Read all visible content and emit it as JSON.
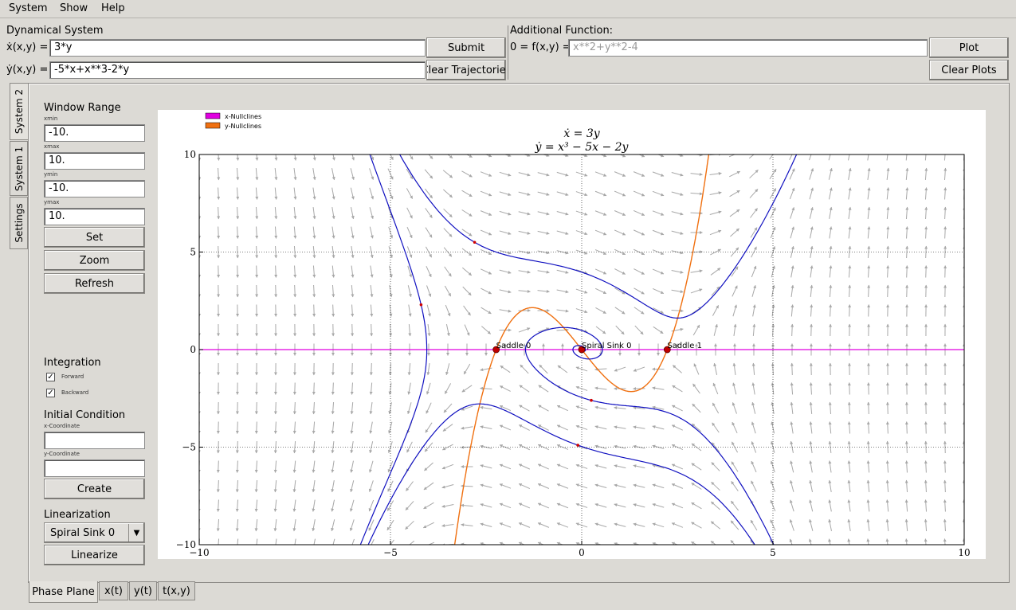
{
  "menu": {
    "items": [
      {
        "label": "System"
      },
      {
        "label": "Show"
      },
      {
        "label": "Help"
      }
    ]
  },
  "system": {
    "title": "Dynamical System",
    "xdot_label": "ẋ(x,y) =",
    "xdot_value": "3*y",
    "ydot_label": "ẏ(x,y) =",
    "ydot_value": "-5*x+x**3-2*y",
    "submit_label": "Submit",
    "clear_label": "Clear Trajectories"
  },
  "additional": {
    "title": "Additional Function:",
    "f_label": "0 = f(x,y) =",
    "f_placeholder": "x**2+y**2-4",
    "plot_label": "Plot",
    "clear_plots_label": "Clear Plots"
  },
  "side_tabs": [
    "System 2",
    "System 1",
    "Settings"
  ],
  "window_range": {
    "title": "Window Range",
    "xmin_label": "xmin",
    "xmin": "-10.",
    "xmax_label": "xmax",
    "xmax": "10.",
    "ymin_label": "ymin",
    "ymin": "-10.",
    "ymax_label": "ymax",
    "ymax": "10.",
    "set_label": "Set",
    "zoom_label": "Zoom",
    "refresh_label": "Refresh"
  },
  "integration": {
    "title": "Integration",
    "forward_label": "Forward",
    "forward_checked": true,
    "backward_label": "Backward",
    "backward_checked": true
  },
  "initial_condition": {
    "title": "Initial Condition",
    "x_label": "x-Coordinate",
    "x_value": "",
    "y_label": "y-Coordinate",
    "y_value": "",
    "create_label": "Create"
  },
  "linearization": {
    "title": "Linearization",
    "selected": "Spiral Sink 0",
    "linearize_label": "Linearize"
  },
  "bottom_tabs": [
    "Phase Plane",
    "x(t)",
    "y(t)",
    "t(x,y)"
  ],
  "chart_data": {
    "type": "phase-plane",
    "title_line1": "ẋ = 3y",
    "title_line2": "ẏ = x³ − 5x − 2y",
    "xlim": [
      -10,
      10
    ],
    "ylim": [
      -10,
      10
    ],
    "xticks": [
      -10,
      -5,
      0,
      5,
      10
    ],
    "yticks": [
      -10,
      -5,
      0,
      5,
      10
    ],
    "grid": true,
    "legend_position": "top-left",
    "legend": [
      {
        "name": "x-Nullclines",
        "color": "#e000e0"
      },
      {
        "name": "y-Nullclines",
        "color": "#f07010"
      }
    ],
    "vector_field_color": "#a8a8a8",
    "trajectory_color": "#1010c0",
    "equilibria": [
      {
        "label": "Saddle 0",
        "x": -2.236,
        "y": 0
      },
      {
        "label": "Spiral Sink 0",
        "x": 0,
        "y": 0
      },
      {
        "label": "Saddle 1",
        "x": 2.236,
        "y": 0
      }
    ],
    "initial_points": [
      {
        "x": -2.8,
        "y": 5.5
      },
      {
        "x": -4.2,
        "y": 2.3
      },
      {
        "x": 0.25,
        "y": -2.6
      },
      {
        "x": -0.1,
        "y": -4.9
      }
    ]
  }
}
